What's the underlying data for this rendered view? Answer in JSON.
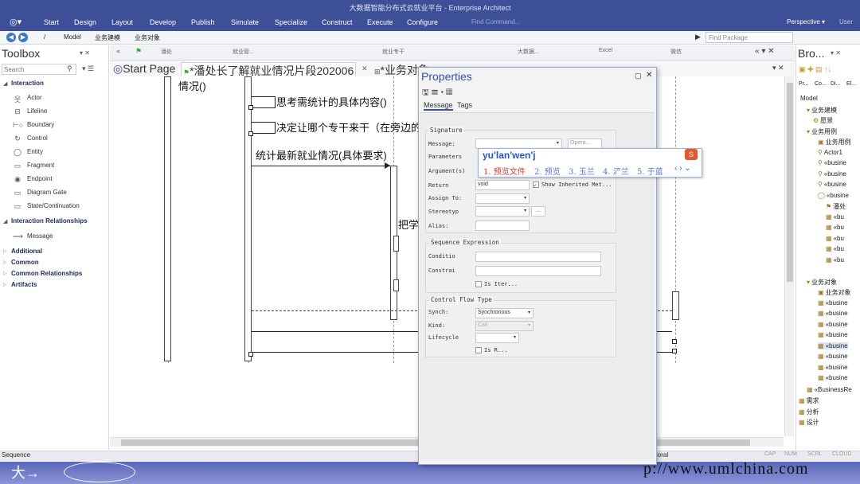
{
  "app": {
    "title": "大数据智能分布式云就业平台 - Enterprise Architect"
  },
  "menu": {
    "items": [
      "Start",
      "Design",
      "Layout",
      "Develop",
      "Publish",
      "Simulate",
      "Specialize",
      "Construct",
      "Execute",
      "Configure"
    ],
    "find_command_placeholder": "Find Command...",
    "perspective": "Perspective",
    "user": "User"
  },
  "address": {
    "crumbs": [
      "/",
      "Model",
      "业务建模",
      "业务对象"
    ],
    "find_package_placeholder": "Find Package"
  },
  "toolbox": {
    "title": "Toolbox",
    "search_placeholder": "Search",
    "sections": [
      {
        "name": "Interaction",
        "items": [
          "Actor",
          "Lifeline",
          "Boundary",
          "Control",
          "Entity",
          "Fragment",
          "Endpoint",
          "Diagram Gate",
          "State/Continuation"
        ]
      },
      {
        "name": "Interaction Relationships",
        "items": [
          "Message"
        ]
      }
    ],
    "collapsed": [
      "Additional",
      "Common",
      "Common Relationships",
      "Artifacts"
    ]
  },
  "diagram": {
    "lane_headers": [
      "潘处",
      "就业管...",
      "就业专干",
      "大数据...",
      "Excel",
      "微信"
    ],
    "tabs": [
      "Start Page",
      "*潘处长了解就业情况片段202006",
      "*业务对象"
    ],
    "messages": [
      "情况()",
      "思考需统计的具体内容()",
      "决定让哪个专干来干（在旁边的",
      "统计最新就业情况(具体要求)",
      "把学"
    ]
  },
  "properties": {
    "title": "Properties",
    "tabs": [
      "Message",
      "Tags"
    ],
    "signature_group": "Signature",
    "fields": {
      "message": "Message:",
      "parameters": "Parameters",
      "arguments": "Argument(s)",
      "return": "Return",
      "return_value": "void",
      "show_inherited": "Show Inherited Met...",
      "assign_to": "Assign To:",
      "stereotype": "Stereotyp",
      "alias": "Alias:",
      "operations_btn": "Opera..."
    },
    "sequence_group": "Sequence Expression",
    "sequence_fields": {
      "condition": "Conditio",
      "constraint": "Constrai",
      "is_iter": "Is Iter..."
    },
    "control_group": "Control Flow Type",
    "control_fields": {
      "synch": "Synch:",
      "synch_value": "Synchronous",
      "kind": "Kind:",
      "kind_value": "Call",
      "lifecycle": "Lifecycle",
      "is_r": "Is R..."
    }
  },
  "ime": {
    "input": "yu'lan'wen'j",
    "candidates": [
      "1. 预览文件",
      "2. 预览",
      "3. 玉兰",
      "4. 浐兰",
      "5. 于蓝"
    ]
  },
  "browser": {
    "title": "Bro...",
    "subtabs": [
      "Pr...",
      "Co...",
      "Di...",
      "El..."
    ],
    "tree": [
      "Model",
      "业务建模",
      "愿景",
      "业务用例",
      "业务用例",
      "Actor1",
      "«busine",
      "«busine",
      "«busine",
      "«busine",
      "潘处",
      "«bu",
      "«bu",
      "«bu",
      "«bu",
      "«bu",
      "业务对象",
      "业务对象",
      "«busine",
      "«busine",
      "«busine",
      "«busine",
      "«busine",
      "«busine",
      "«busine",
      "«busine",
      "«BusinessRe",
      "需求",
      "分析",
      "设计"
    ]
  },
  "status": {
    "left": "Sequence",
    "keys": [
      "CAP",
      "NUM",
      "SCRL",
      "CLOUD"
    ],
    "mid": "vioral"
  },
  "watermark": "p://www.umlchina.com"
}
